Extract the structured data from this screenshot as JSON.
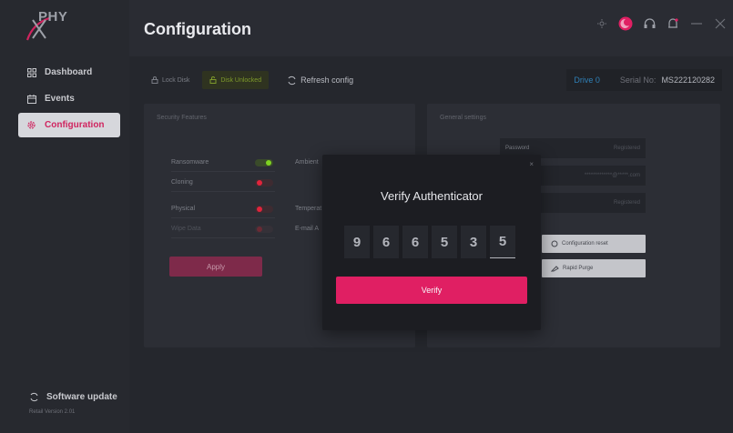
{
  "app": {
    "logo_text": "PHY"
  },
  "header": {
    "title": "Configuration"
  },
  "sidebar": {
    "items": [
      {
        "label": "Dashboard",
        "icon": "dashboard-icon"
      },
      {
        "label": "Events",
        "icon": "calendar-icon"
      },
      {
        "label": "Configuration",
        "icon": "gear-icon",
        "active": true
      }
    ],
    "software_update": "Software update",
    "version": "Retail Version 2.01"
  },
  "toolbar": {
    "lock_disk": "Lock Disk",
    "disk_unlocked": "Disk Unlocked",
    "refresh_config": "Refresh config",
    "drive": "Drive 0",
    "serial_label": "Serial No:",
    "serial_value": "MS222120282"
  },
  "security": {
    "title": "Security Features",
    "features": [
      {
        "label": "Ransomware",
        "state": "on"
      },
      {
        "label": "Cloning",
        "state": "off"
      },
      {
        "label": "Physical",
        "state": "off"
      },
      {
        "label": "Wipe Data",
        "state": "dim"
      }
    ],
    "col2": [
      "Ambient",
      "Temperat",
      "E-mail A"
    ],
    "apply": "Apply"
  },
  "general": {
    "title": "General settings",
    "fields": [
      {
        "label": "Password",
        "right": "Registered"
      },
      {
        "label": "",
        "right": "*************@*****.com"
      },
      {
        "label": "y",
        "right": "Registered"
      }
    ],
    "config_reset": "Configuration reset",
    "rapid_purge": "Rapid Purge"
  },
  "modal": {
    "title": "Verify Authenticator",
    "close": "×",
    "digits": [
      "9",
      "6",
      "6",
      "5",
      "3",
      "5"
    ],
    "verify": "Verify"
  },
  "colors": {
    "accent": "#e01f63",
    "active_nav": "#d0245f",
    "toggle_on": "#7ed321",
    "toggle_off": "#e0243c",
    "drive": "#2f7fb5"
  }
}
